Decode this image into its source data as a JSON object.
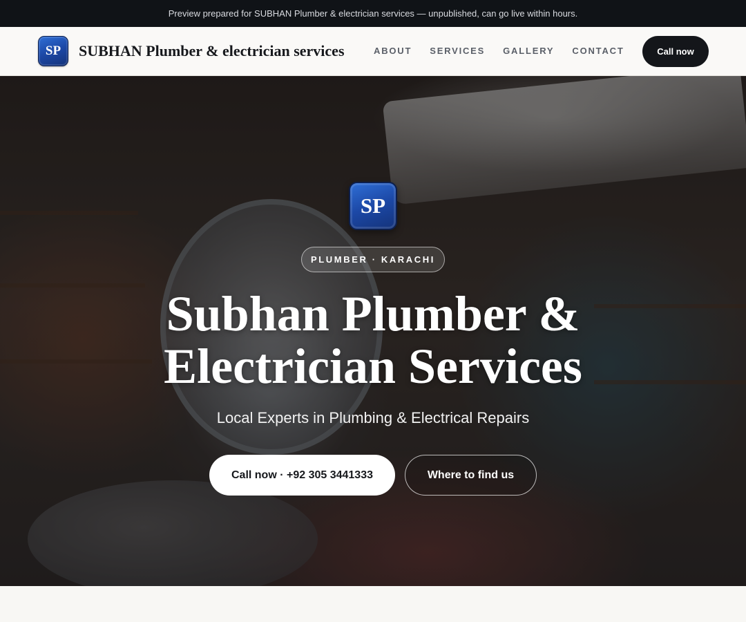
{
  "banner": {
    "text": "Preview prepared for SUBHAN Plumber & electrician services — unpublished, can go live within hours."
  },
  "header": {
    "logo_initials": "SP",
    "brand_name": "SUBHAN Plumber & electrician services",
    "nav": [
      {
        "label": "ABOUT"
      },
      {
        "label": "SERVICES"
      },
      {
        "label": "GALLERY"
      },
      {
        "label": "CONTACT"
      }
    ],
    "cta_label": "Call now"
  },
  "hero": {
    "logo_initials": "SP",
    "eyebrow": "PLUMBER · KARACHI",
    "title_line1": "Subhan Plumber &",
    "title_line2": "Electrician Services",
    "subtitle": "Local Experts in Plumbing & Electrical Repairs",
    "primary_button": "Call now · +92 305 3441333",
    "secondary_button": "Where to find us"
  },
  "colors": {
    "banner_bg": "#101317",
    "header_bg": "#faf9f7",
    "brand_blue": "#1c48a6",
    "dark_button": "#14161a",
    "page_bg": "#f8f7f4"
  }
}
